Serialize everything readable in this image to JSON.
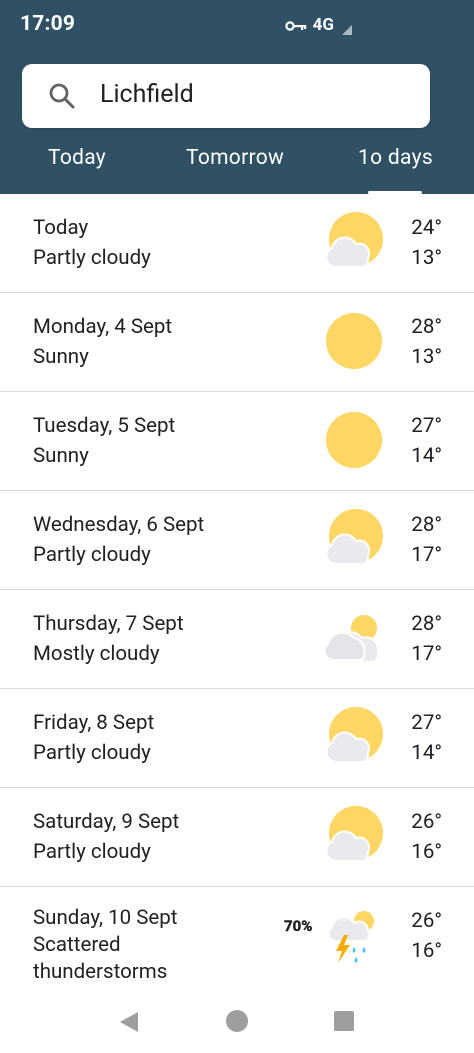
{
  "status_bar": {
    "time": "17:09",
    "network": "4G"
  },
  "search": {
    "query": "Lichfield"
  },
  "tabs": [
    {
      "label": "Today",
      "selected": false
    },
    {
      "label": "Tomorrow",
      "selected": false
    },
    {
      "label": "1o days",
      "selected": true
    }
  ],
  "forecast": [
    {
      "day": "Today",
      "condition": "Partly cloudy",
      "icon": "partly-cloudy-icon",
      "high": "24°",
      "low": "13°"
    },
    {
      "day": "Monday, 4 Sept",
      "condition": "Sunny",
      "icon": "sunny-icon",
      "high": "28°",
      "low": "13°"
    },
    {
      "day": "Tuesday, 5 Sept",
      "condition": "Sunny",
      "icon": "sunny-icon",
      "high": "27°",
      "low": "14°"
    },
    {
      "day": "Wednesday, 6 Sept",
      "condition": "Partly cloudy",
      "icon": "partly-cloudy-icon",
      "high": "28°",
      "low": "17°"
    },
    {
      "day": "Thursday, 7 Sept",
      "condition": "Mostly cloudy",
      "icon": "mostly-cloudy-icon",
      "high": "28°",
      "low": "17°"
    },
    {
      "day": "Friday, 8 Sept",
      "condition": "Partly cloudy",
      "icon": "partly-cloudy-icon",
      "high": "27°",
      "low": "14°"
    },
    {
      "day": "Saturday, 9 Sept",
      "condition": "Partly cloudy",
      "icon": "partly-cloudy-icon",
      "high": "26°",
      "low": "16°"
    },
    {
      "day": "Sunday, 10 Sept",
      "condition": "Scattered thunderstorms",
      "icon": "thunderstorm-icon",
      "precipitation": "70%",
      "high": "26°",
      "low": "16°"
    }
  ],
  "colors": {
    "header": "#2f5163",
    "sun": "#fdd663",
    "cloud": "#e8eaed",
    "divider": "#d9d9d9"
  }
}
